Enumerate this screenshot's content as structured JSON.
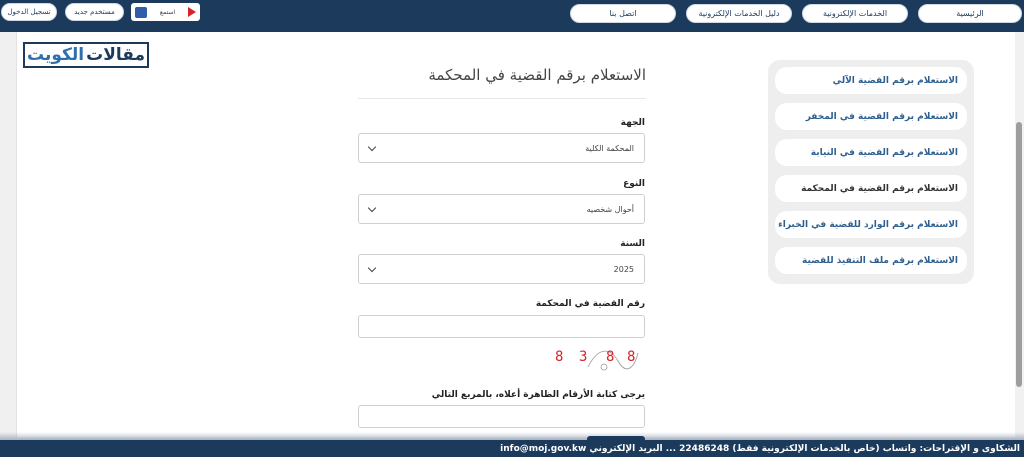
{
  "topnav": {
    "login": "تسجيل الدخول",
    "new_user": "مستخدم جديد",
    "listen": "استمع",
    "home": "الرئيسية",
    "eservices": "الخدمات الإلكترونية",
    "eservices_guide": "دليل الخدمات الإلكترونية",
    "contact": "اتصل بنا"
  },
  "logo": {
    "part1": "مقالات",
    "part2": "الكويت"
  },
  "sidebar": {
    "items": [
      {
        "label": "الاستعلام برقم القضية الآلي",
        "active": false
      },
      {
        "label": "الاستعلام برقم القضية في المخفر",
        "active": false
      },
      {
        "label": "الاستعلام برقم القضية في النيابة",
        "active": false
      },
      {
        "label": "الاستعلام برقم القضية في المحكمة",
        "active": true
      },
      {
        "label": "الاستعلام برقم الوارد للقضية في الخبراء",
        "active": false
      },
      {
        "label": "الاستعلام برقم ملف التنفيذ للقضية",
        "active": false
      }
    ]
  },
  "form": {
    "title": "الاستعلام برقم القضية في المحكمة",
    "entity_label": "الجهة",
    "entity_value": "المحكمة الكلية",
    "type_label": "النوع",
    "type_value": "أحوال شخصيه",
    "year_label": "السنة",
    "year_value": "2025",
    "case_number_label": "رقم القضية في المحكمة",
    "case_number_value": "",
    "captcha_digits": [
      "8",
      "8",
      "3",
      "8"
    ],
    "captcha_instruction": "يرجى كتابة الأرقام الظاهرة أعلاه، بالمربع التالي",
    "captcha_value": ""
  },
  "footer": {
    "text": "الشكاوى و الإقتراحات: واتساب (خاص بالخدمات الإلكترونية فقط) 22486248 ... البريد الإلكتروني info@moj.gov.kw"
  },
  "colors": {
    "nav": "#1b3a5c",
    "link": "#2f5f8f",
    "captcha": "#d9232a"
  }
}
